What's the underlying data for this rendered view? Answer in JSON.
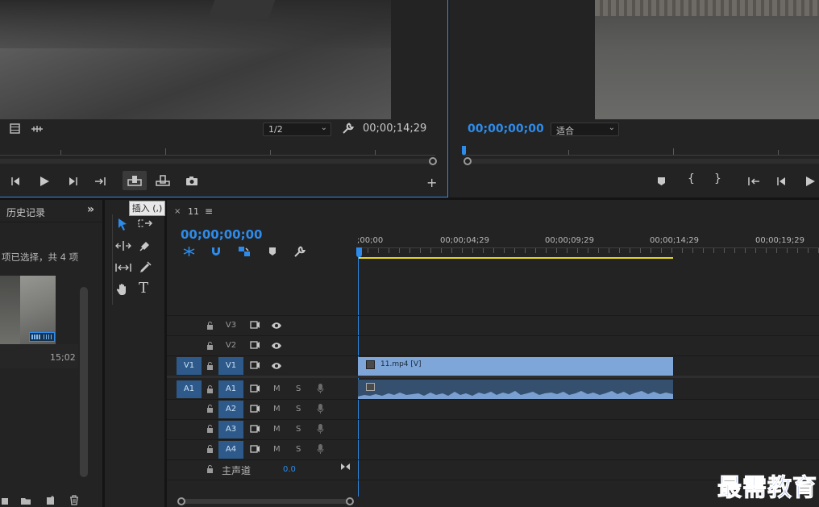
{
  "source_monitor": {
    "zoom_select": "1/2",
    "timecode": "00;00;14;29"
  },
  "program_monitor": {
    "timecode": "00;00;00;00",
    "fit_select": "适合"
  },
  "tooltip": "插入 (,)",
  "history_panel": {
    "title": "历史记录",
    "selection_text": "项已选择，共 4 项",
    "duration": "15;02"
  },
  "timeline": {
    "tab_label": "11",
    "timecode": "00;00;00;00",
    "ruler_labels": [
      ";00;00",
      "00;00;04;29",
      "00;00;09;29",
      "00;00;14;29",
      "00;00;19;29"
    ],
    "video_tracks": [
      {
        "source": "",
        "name": "V3"
      },
      {
        "source": "",
        "name": "V2"
      },
      {
        "source": "V1",
        "name": "V1"
      }
    ],
    "audio_tracks": [
      {
        "source": "A1",
        "name": "A1",
        "m": "M",
        "s": "S"
      },
      {
        "source": "",
        "name": "A2",
        "m": "M",
        "s": "S"
      },
      {
        "source": "",
        "name": "A3",
        "m": "M",
        "s": "S"
      },
      {
        "source": "",
        "name": "A4",
        "m": "M",
        "s": "S"
      }
    ],
    "master_label": "主声道",
    "master_value": "0.0",
    "video_clip_label": "11.mp4 [V]"
  },
  "colors": {
    "accent": "#2d8ceb",
    "clip_video": "#7fa6d8",
    "clip_audio": "#7aa0d2",
    "work_area": "#e5d61e"
  },
  "watermark": "最需教育"
}
